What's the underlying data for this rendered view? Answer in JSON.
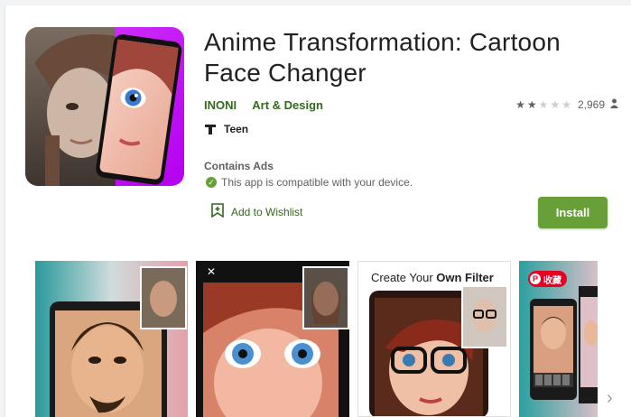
{
  "app": {
    "title": "Anime Transformation: Cartoon Face Changer",
    "developer": "INONI",
    "category": "Art & Design",
    "rating_stars": 2,
    "rating_max": 5,
    "review_count": "2,969",
    "content_rating": "Teen",
    "ads_label": "Contains Ads",
    "compat_text": "This app is compatible with your device.",
    "wishlist_label": "Add to Wishlist",
    "install_label": "Install"
  },
  "screenshots": [
    {
      "label": ""
    },
    {
      "label": ""
    },
    {
      "title_pre": "Create Your ",
      "title_bold": "Own Filter"
    },
    {
      "badge": "收藏"
    }
  ],
  "colors": {
    "accent_green": "#689f38",
    "link_green": "#33691e",
    "icon_bg": "#c41dff"
  },
  "icons": [
    "teen-icon",
    "info-check-icon",
    "wishlist-bookmark-icon",
    "person-icon",
    "close-icon",
    "pinterest-icon",
    "chevron-right-icon"
  ]
}
